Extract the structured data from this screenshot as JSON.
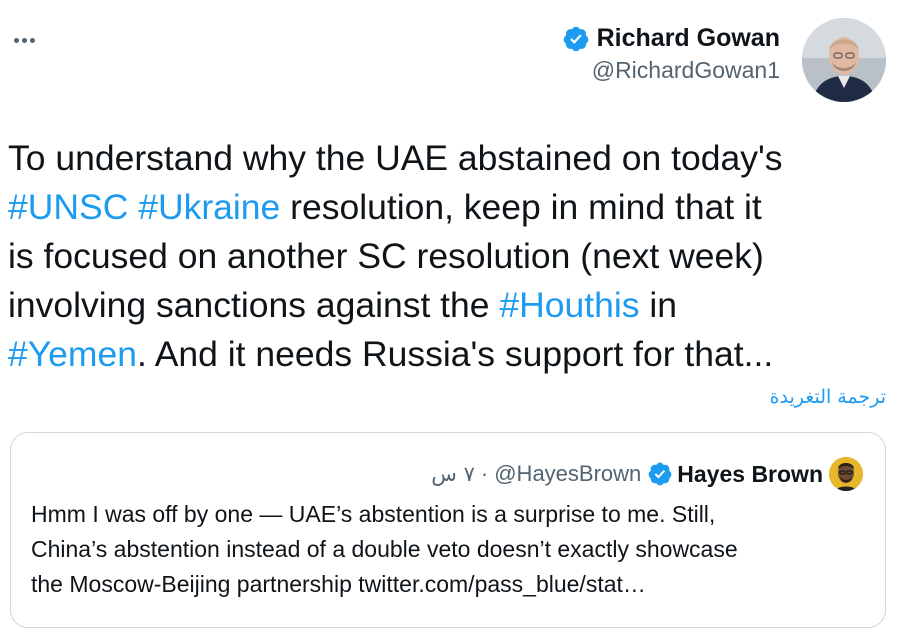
{
  "tweet": {
    "author": {
      "name": "Richard Gowan",
      "handle": "@RichardGowan1",
      "verified": true
    },
    "text_lines": [
      [
        {
          "t": "To understand why the UAE abstained on today's"
        }
      ],
      [
        {
          "t": "#UNSC",
          "tag": true
        },
        {
          "t": " "
        },
        {
          "t": "#Ukraine",
          "tag": true
        },
        {
          "t": " resolution, keep in mind that it"
        }
      ],
      [
        {
          "t": "is focused on another SC resolution (next week)"
        }
      ],
      [
        {
          "t": "involving sanctions against the "
        },
        {
          "t": "#Houthis",
          "tag": true
        },
        {
          "t": " in"
        }
      ],
      [
        {
          "t": "#Yemen",
          "tag": true
        },
        {
          "t": ".  And it needs Russia's support for that..."
        }
      ]
    ],
    "translate_label": "ترجمة التغريدة"
  },
  "quote": {
    "author": {
      "name": "Hayes Brown",
      "handle": "@HayesBrown",
      "verified": true
    },
    "separator": "·",
    "time": "٧ س",
    "text_lines": [
      "Hmm I was off by one — UAE’s abstention is a surprise to me. Still,",
      "China’s abstention instead of a double veto doesn’t exactly showcase",
      "the Moscow-Beijing partnership twitter.com/pass_blue/stat…"
    ]
  },
  "colors": {
    "accent": "#1d9bf0",
    "text": "#0f1419",
    "muted": "#536471",
    "border": "#cfd9de"
  },
  "icons": {
    "more": "more-options-icon",
    "verified": "verified-badge-icon"
  }
}
